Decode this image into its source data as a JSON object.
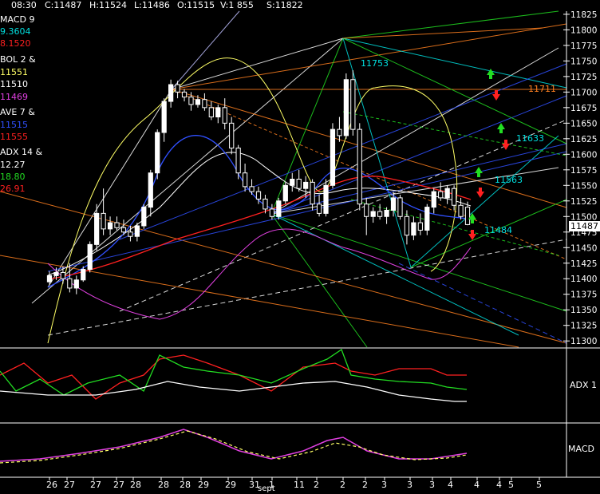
{
  "header": {
    "time": "08:30",
    "close": "C:11487",
    "high": "H:11524",
    "low": "L:11486",
    "open": "O:11515",
    "volume": "V:1 855",
    "settle": "S:11822"
  },
  "indicators": {
    "macd_label": "MACD 9",
    "macd_v1": "9.3604",
    "macd_v2": "8.1520",
    "bol_label": "BOL 2 &",
    "bol_v1": "11551",
    "bol_v2": "11510",
    "bol_v3": "11469",
    "ave_label": "AVE 7 &",
    "ave_v1": "11515",
    "ave_v2": "11555",
    "adx_label": "ADX 14 &",
    "adx_v1": "12.27",
    "adx_v2": "18.80",
    "adx_v3": "26.91"
  },
  "colors": {
    "background": "#000000",
    "axis": "#ffffff",
    "macd_v1": "#00e0e0",
    "macd_v2": "#ff2020",
    "bol_v1": "#ffff66",
    "bol_v2": "#ffffff",
    "bol_v3": "#e040e0",
    "ave_v1": "#3050ff",
    "ave_v2": "#ff2020",
    "adx_v1": "#ffffff",
    "adx_v2": "#22dd22",
    "adx_v3": "#ff2020",
    "up_arrow": "#22dd22",
    "down_arrow": "#ff2020"
  },
  "annotations": [
    {
      "text": "11753",
      "color": "#00e0e0"
    },
    {
      "text": "11711",
      "color": "#ff8020"
    },
    {
      "text": "11633",
      "color": "#00e0e0"
    },
    {
      "text": "11563",
      "color": "#00e0e0"
    },
    {
      "text": "11484",
      "color": "#00e0e0"
    }
  ],
  "panels": {
    "adx_label": "ADX 1",
    "macd_label": "MACD"
  },
  "chart_data": {
    "type": "candlestick",
    "ylim": [
      11290,
      11830
    ],
    "y_ticks": [
      11300,
      11325,
      11350,
      11375,
      11400,
      11425,
      11450,
      11475,
      11500,
      11525,
      11550,
      11575,
      11600,
      11625,
      11650,
      11675,
      11700,
      11725,
      11750,
      11775,
      11800,
      11825
    ],
    "y_tick_labels": [
      "11300",
      "11325",
      "11350",
      "11375",
      "11400",
      "11425",
      "11450",
      "11475",
      "11500",
      "11525",
      "11550",
      "11575",
      "11600",
      "11625",
      "11650",
      "11675",
      "11700",
      "11725",
      "11750",
      "11775",
      "11800",
      "11825"
    ],
    "last_price": "11487",
    "x_tick_labels": [
      "26",
      "27",
      "27",
      "27",
      "28",
      "28",
      "28",
      "29",
      "29",
      "31",
      "1",
      "11",
      "2",
      "2",
      "2",
      "3",
      "3",
      "3",
      "4",
      "4",
      "4",
      "5",
      "5"
    ],
    "x_sub_label": "sept",
    "candles": [
      {
        "o": 11395,
        "h": 11412,
        "l": 11390,
        "c": 11405
      },
      {
        "o": 11405,
        "h": 11418,
        "l": 11398,
        "c": 11410
      },
      {
        "o": 11410,
        "h": 11420,
        "l": 11392,
        "c": 11400
      },
      {
        "o": 11400,
        "h": 11425,
        "l": 11378,
        "c": 11385
      },
      {
        "o": 11385,
        "h": 11405,
        "l": 11375,
        "c": 11398
      },
      {
        "o": 11398,
        "h": 11420,
        "l": 11395,
        "c": 11415
      },
      {
        "o": 11415,
        "h": 11460,
        "l": 11410,
        "c": 11455
      },
      {
        "o": 11455,
        "h": 11520,
        "l": 11445,
        "c": 11505
      },
      {
        "o": 11505,
        "h": 11545,
        "l": 11470,
        "c": 11480
      },
      {
        "o": 11480,
        "h": 11500,
        "l": 11470,
        "c": 11490
      },
      {
        "o": 11490,
        "h": 11500,
        "l": 11478,
        "c": 11482
      },
      {
        "o": 11482,
        "h": 11495,
        "l": 11470,
        "c": 11475
      },
      {
        "o": 11475,
        "h": 11485,
        "l": 11460,
        "c": 11468
      },
      {
        "o": 11468,
        "h": 11490,
        "l": 11460,
        "c": 11485
      },
      {
        "o": 11485,
        "h": 11520,
        "l": 11480,
        "c": 11515
      },
      {
        "o": 11515,
        "h": 11575,
        "l": 11500,
        "c": 11570
      },
      {
        "o": 11570,
        "h": 11640,
        "l": 11560,
        "c": 11635
      },
      {
        "o": 11635,
        "h": 11690,
        "l": 11620,
        "c": 11685
      },
      {
        "o": 11685,
        "h": 11720,
        "l": 11675,
        "c": 11712
      },
      {
        "o": 11712,
        "h": 11718,
        "l": 11690,
        "c": 11700
      },
      {
        "o": 11700,
        "h": 11705,
        "l": 11685,
        "c": 11692
      },
      {
        "o": 11692,
        "h": 11700,
        "l": 11670,
        "c": 11680
      },
      {
        "o": 11680,
        "h": 11695,
        "l": 11675,
        "c": 11688
      },
      {
        "o": 11688,
        "h": 11698,
        "l": 11670,
        "c": 11675
      },
      {
        "o": 11675,
        "h": 11685,
        "l": 11655,
        "c": 11660
      },
      {
        "o": 11660,
        "h": 11680,
        "l": 11650,
        "c": 11675
      },
      {
        "o": 11675,
        "h": 11690,
        "l": 11640,
        "c": 11650
      },
      {
        "o": 11650,
        "h": 11660,
        "l": 11600,
        "c": 11610
      },
      {
        "o": 11610,
        "h": 11615,
        "l": 11560,
        "c": 11570
      },
      {
        "o": 11570,
        "h": 11585,
        "l": 11540,
        "c": 11548
      },
      {
        "o": 11548,
        "h": 11560,
        "l": 11535,
        "c": 11540
      },
      {
        "o": 11540,
        "h": 11548,
        "l": 11520,
        "c": 11528
      },
      {
        "o": 11528,
        "h": 11535,
        "l": 11505,
        "c": 11512
      },
      {
        "o": 11512,
        "h": 11520,
        "l": 11495,
        "c": 11500
      },
      {
        "o": 11500,
        "h": 11530,
        "l": 11495,
        "c": 11525
      },
      {
        "o": 11525,
        "h": 11555,
        "l": 11520,
        "c": 11550
      },
      {
        "o": 11550,
        "h": 11570,
        "l": 11540,
        "c": 11560
      },
      {
        "o": 11560,
        "h": 11575,
        "l": 11540,
        "c": 11545
      },
      {
        "o": 11545,
        "h": 11565,
        "l": 11530,
        "c": 11555
      },
      {
        "o": 11555,
        "h": 11560,
        "l": 11510,
        "c": 11520
      },
      {
        "o": 11520,
        "h": 11535,
        "l": 11500,
        "c": 11505
      },
      {
        "o": 11505,
        "h": 11560,
        "l": 11500,
        "c": 11550
      },
      {
        "o": 11550,
        "h": 11650,
        "l": 11545,
        "c": 11640
      },
      {
        "o": 11640,
        "h": 11660,
        "l": 11620,
        "c": 11630
      },
      {
        "o": 11630,
        "h": 11730,
        "l": 11625,
        "c": 11720
      },
      {
        "o": 11720,
        "h": 11735,
        "l": 11630,
        "c": 11640
      },
      {
        "o": 11640,
        "h": 11650,
        "l": 11510,
        "c": 11520
      },
      {
        "o": 11520,
        "h": 11530,
        "l": 11470,
        "c": 11500
      },
      {
        "o": 11500,
        "h": 11515,
        "l": 11490,
        "c": 11508
      },
      {
        "o": 11508,
        "h": 11520,
        "l": 11495,
        "c": 11500
      },
      {
        "o": 11500,
        "h": 11515,
        "l": 11488,
        "c": 11510
      },
      {
        "o": 11510,
        "h": 11540,
        "l": 11500,
        "c": 11530
      },
      {
        "o": 11530,
        "h": 11535,
        "l": 11495,
        "c": 11500
      },
      {
        "o": 11500,
        "h": 11510,
        "l": 11455,
        "c": 11470
      },
      {
        "o": 11470,
        "h": 11500,
        "l": 11462,
        "c": 11490
      },
      {
        "o": 11490,
        "h": 11505,
        "l": 11470,
        "c": 11478
      },
      {
        "o": 11478,
        "h": 11520,
        "l": 11470,
        "c": 11515
      },
      {
        "o": 11515,
        "h": 11545,
        "l": 11505,
        "c": 11540
      },
      {
        "o": 11540,
        "h": 11555,
        "l": 11525,
        "c": 11530
      },
      {
        "o": 11530,
        "h": 11550,
        "l": 11520,
        "c": 11545
      },
      {
        "o": 11545,
        "h": 11550,
        "l": 11510,
        "c": 11518
      },
      {
        "o": 11518,
        "h": 11530,
        "l": 11495,
        "c": 11500
      },
      {
        "o": 11515,
        "h": 11524,
        "l": 11486,
        "c": 11487
      }
    ]
  }
}
